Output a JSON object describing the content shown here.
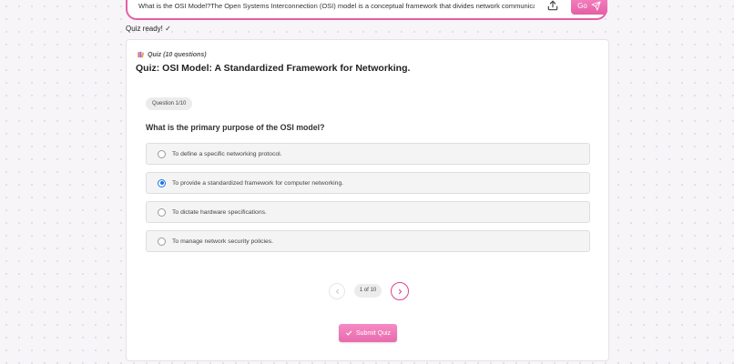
{
  "prompt": {
    "text": "What is the OSI Model?The Open Systems Interconnection (OSI) model is a conceptual framework that divides network communications functions i",
    "go_label": "Go",
    "upload_icon": "upload-icon",
    "send_icon": "send-icon"
  },
  "status": {
    "text": "Quiz ready! ✓"
  },
  "quiz": {
    "tag": "Quiz (10 questions)",
    "tag_icon": "books-icon",
    "title": "Quiz: OSI Model: A Standardized Framework for Networking.",
    "question_badge": "Question 1/10",
    "question": "What is the primary purpose of the OSI model?",
    "options": [
      {
        "label": "To define a specific networking protocol.",
        "selected": false
      },
      {
        "label": "To provide a standardized framework for computer networking.",
        "selected": true
      },
      {
        "label": "To dictate hardware specifications.",
        "selected": false
      },
      {
        "label": "To manage network security policies.",
        "selected": false
      }
    ],
    "pagination": {
      "text": "1 of 10",
      "current": 1,
      "total": 10
    },
    "submit_label": "Submit Quiz"
  },
  "colors": {
    "accent": "#e55fa4",
    "radio_selected": "#1a73e8",
    "border": "#e35fa6"
  }
}
